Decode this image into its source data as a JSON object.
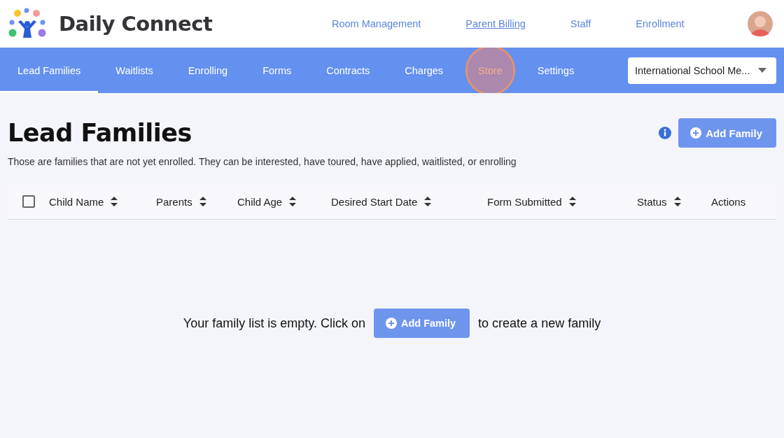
{
  "brand": {
    "name": "Daily Connect"
  },
  "top_nav": [
    {
      "label": "Room Management",
      "selected": false
    },
    {
      "label": "Parent Billing",
      "selected": true
    },
    {
      "label": "Staff",
      "selected": false
    },
    {
      "label": "Enrollment",
      "selected": false
    }
  ],
  "tabs": [
    {
      "label": "Lead Families",
      "selected": true,
      "highlighted": false
    },
    {
      "label": "Waitlists",
      "selected": false,
      "highlighted": false
    },
    {
      "label": "Enrolling",
      "selected": false,
      "highlighted": false
    },
    {
      "label": "Forms",
      "selected": false,
      "highlighted": false
    },
    {
      "label": "Contracts",
      "selected": false,
      "highlighted": false
    },
    {
      "label": "Charges",
      "selected": false,
      "highlighted": false
    },
    {
      "label": "Store",
      "selected": false,
      "highlighted": true
    },
    {
      "label": "Settings",
      "selected": false,
      "highlighted": false
    }
  ],
  "school_select": {
    "value": "International School Me..."
  },
  "page": {
    "title": "Lead Families",
    "description": "Those are families that are not yet enrolled. They can be interested, have toured, have applied, waitlisted, or enrolling",
    "add_button": "Add Family"
  },
  "table": {
    "select_all": {
      "checked": false
    },
    "columns": [
      {
        "label": "Child Name",
        "sortable": true
      },
      {
        "label": "Parents",
        "sortable": true
      },
      {
        "label": "Child Age",
        "sortable": true
      },
      {
        "label": "Desired Start Date",
        "sortable": true
      },
      {
        "label": "Form Submitted",
        "sortable": true
      },
      {
        "label": "Status",
        "sortable": true
      },
      {
        "label": "Actions",
        "sortable": false
      }
    ]
  },
  "empty_state": {
    "before": "Your family list is empty. Click on",
    "button": "Add Family",
    "after": "to create a new family"
  }
}
